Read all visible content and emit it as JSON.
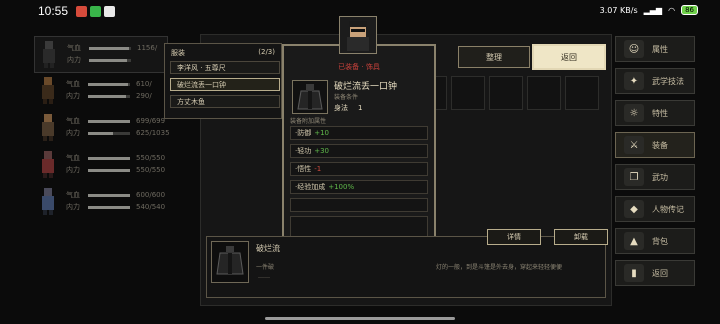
{
  "status_bar": {
    "time": "10:55",
    "signal_text": "3.07 KB/s",
    "battery": "86"
  },
  "party": [
    {
      "hp_label": "气血",
      "mp_label": "内力",
      "hp_value": "1156/",
      "mp_value": "",
      "hp_fill": 0.95,
      "mp_fill": 0.9,
      "selected": true
    },
    {
      "hp_label": "气血",
      "mp_label": "内力",
      "hp_value": "610/",
      "mp_value": "290/",
      "hp_fill": 0.95,
      "mp_fill": 0.9,
      "selected": false
    },
    {
      "hp_label": "气血",
      "mp_label": "内力",
      "hp_value": "699/699",
      "mp_value": "625/1035",
      "hp_fill": 1.0,
      "mp_fill": 0.6,
      "selected": false
    },
    {
      "hp_label": "气血",
      "mp_label": "内力",
      "hp_value": "550/550",
      "mp_value": "550/550",
      "hp_fill": 1.0,
      "mp_fill": 1.0,
      "selected": false
    },
    {
      "hp_label": "气血",
      "mp_label": "内力",
      "hp_value": "600/600",
      "mp_value": "540/540",
      "hp_fill": 1.0,
      "mp_fill": 1.0,
      "selected": false
    }
  ],
  "equip_list": {
    "header": "服装",
    "count": "(2/3)",
    "items": [
      "李洋风 · 五尊尺",
      "破烂流丢一口钟",
      "方丈木鱼"
    ]
  },
  "detail": {
    "status": "已装备 · 饰具",
    "name": "破烂流丢一口钟",
    "req_label": "装备条件",
    "req_stat": "身法",
    "req_value": "1",
    "attr_header": "装备附加属性",
    "attrs": [
      {
        "name": "·防御",
        "value": "+10",
        "sign": "plus"
      },
      {
        "name": "·轻功",
        "value": "+30",
        "sign": "plus"
      },
      {
        "name": "·悟性",
        "value": "-1",
        "sign": "minus"
      },
      {
        "name": "·经验加成",
        "value": "+100%",
        "sign": "plus"
      }
    ]
  },
  "top_buttons": {
    "sort": "整理",
    "back": "返回"
  },
  "description": {
    "title": "破烂流",
    "line1": "一件破",
    "line2": "……",
    "tail": "灯的一般，到是斗篷是外去身，穿起来轻轻便便",
    "detail_button": "详情",
    "remove_button": "卸载"
  },
  "right_menu": [
    {
      "label": "属性",
      "icon": "☺"
    },
    {
      "label": "武学技法",
      "icon": "✦"
    },
    {
      "label": "特性",
      "icon": "☼"
    },
    {
      "label": "装备",
      "icon": "⚔"
    },
    {
      "label": "武功",
      "icon": "❐"
    },
    {
      "label": "人物传记",
      "icon": "◆"
    },
    {
      "label": "背包",
      "icon": "▲"
    },
    {
      "label": "返回",
      "icon": "▮"
    }
  ]
}
